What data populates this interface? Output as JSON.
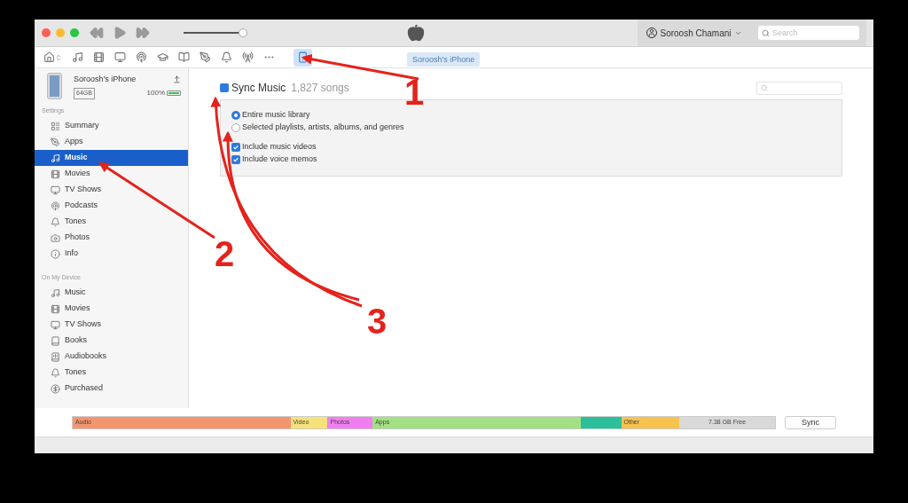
{
  "window": {
    "volume": {
      "level": 0.93
    },
    "account": "Soroosh Chamani",
    "search": {
      "placeholder": "Search"
    }
  },
  "toolbar": {
    "items": [
      {
        "selected": false
      },
      {
        "selected": false
      },
      {
        "selected": false
      },
      {
        "selected": false
      },
      {
        "selected": false
      },
      {
        "selected": false
      },
      {
        "selected": false
      },
      {
        "selected": false
      },
      {
        "selected": false
      },
      {
        "selected": false
      },
      {
        "selected": false
      },
      {
        "selected": true
      }
    ],
    "device_button": "Soroosh's iPhone"
  },
  "device": {
    "name": "Soroosh's iPhone",
    "capacity": "64GB",
    "battery": "100%"
  },
  "sidebar": {
    "sections": [
      {
        "title": "Settings",
        "items": [
          {
            "label": "Summary",
            "selected": false
          },
          {
            "label": "Apps",
            "selected": false
          },
          {
            "label": "Music",
            "selected": true
          },
          {
            "label": "Movies",
            "selected": false
          },
          {
            "label": "TV Shows",
            "selected": false
          },
          {
            "label": "Podcasts",
            "selected": false
          },
          {
            "label": "Tones",
            "selected": false
          },
          {
            "label": "Photos",
            "selected": false
          },
          {
            "label": "Info",
            "selected": false
          }
        ]
      },
      {
        "title": "On My Device",
        "items": [
          {
            "label": "Music",
            "selected": false
          },
          {
            "label": "Movies",
            "selected": false
          },
          {
            "label": "TV Shows",
            "selected": false
          },
          {
            "label": "Books",
            "selected": false
          },
          {
            "label": "Audiobooks",
            "selected": false
          },
          {
            "label": "Tones",
            "selected": false
          },
          {
            "label": "Purchased",
            "selected": false
          }
        ]
      }
    ]
  },
  "main": {
    "sync": {
      "label": "Sync Music",
      "count": "1,827 songs",
      "checked": true
    },
    "options": [
      {
        "kind": "radio",
        "label": "Entire music library",
        "selected": true
      },
      {
        "kind": "radio",
        "label": "Selected playlists, artists, albums, and genres",
        "selected": false
      },
      {
        "kind": "checkbox",
        "label": "Include music videos",
        "checked": true
      },
      {
        "kind": "checkbox",
        "label": "Include voice memos",
        "checked": true
      }
    ]
  },
  "storage": {
    "segments": [
      {
        "label": "Audio",
        "color": "#f5956f"
      },
      {
        "label": "Video",
        "color": "#f7e27a"
      },
      {
        "label": "Photos",
        "color": "#f17ef0"
      },
      {
        "label": "Apps",
        "color": "#a3e083"
      },
      {
        "color": "#2bbf9a"
      },
      {
        "label": "Other",
        "color": "#f8c24e"
      },
      {
        "label": "7.38 GB Free",
        "color": "#d9d9d9"
      }
    ],
    "sync_button": "Sync"
  },
  "annotations": [
    "1",
    "2",
    "3"
  ]
}
